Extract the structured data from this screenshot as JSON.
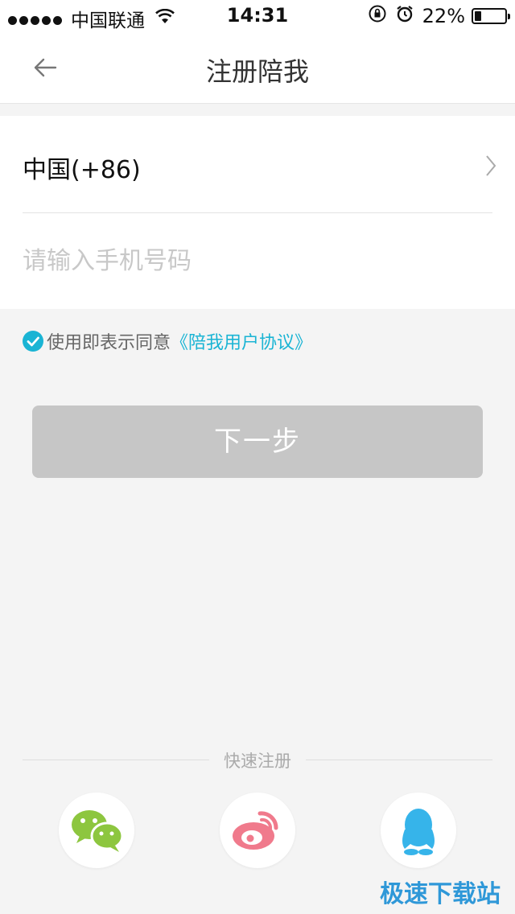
{
  "status_bar": {
    "carrier": "中国联通",
    "time": "14:31",
    "battery": "22%",
    "battery_level": 0.22
  },
  "nav": {
    "title": "注册陪我",
    "back_icon": "arrow-left-icon"
  },
  "form": {
    "country": "中国(+86)",
    "phone_placeholder": "请输入手机号码",
    "phone_value": ""
  },
  "agreement": {
    "text": "使用即表示同意",
    "link": "《陪我用户协议》",
    "checked": true,
    "color": "#1ab4d4"
  },
  "next_button": {
    "label": "下一步",
    "color": "#c6c6c6"
  },
  "quick_register": {
    "label": "快速注册",
    "options": [
      {
        "name": "wechat",
        "icon": "wechat-icon",
        "color": "#8dc63f"
      },
      {
        "name": "weibo",
        "icon": "weibo-icon",
        "color": "#f07a8c"
      },
      {
        "name": "qq",
        "icon": "qq-icon",
        "color": "#36b4ea"
      }
    ]
  },
  "watermark": "极速下载站"
}
